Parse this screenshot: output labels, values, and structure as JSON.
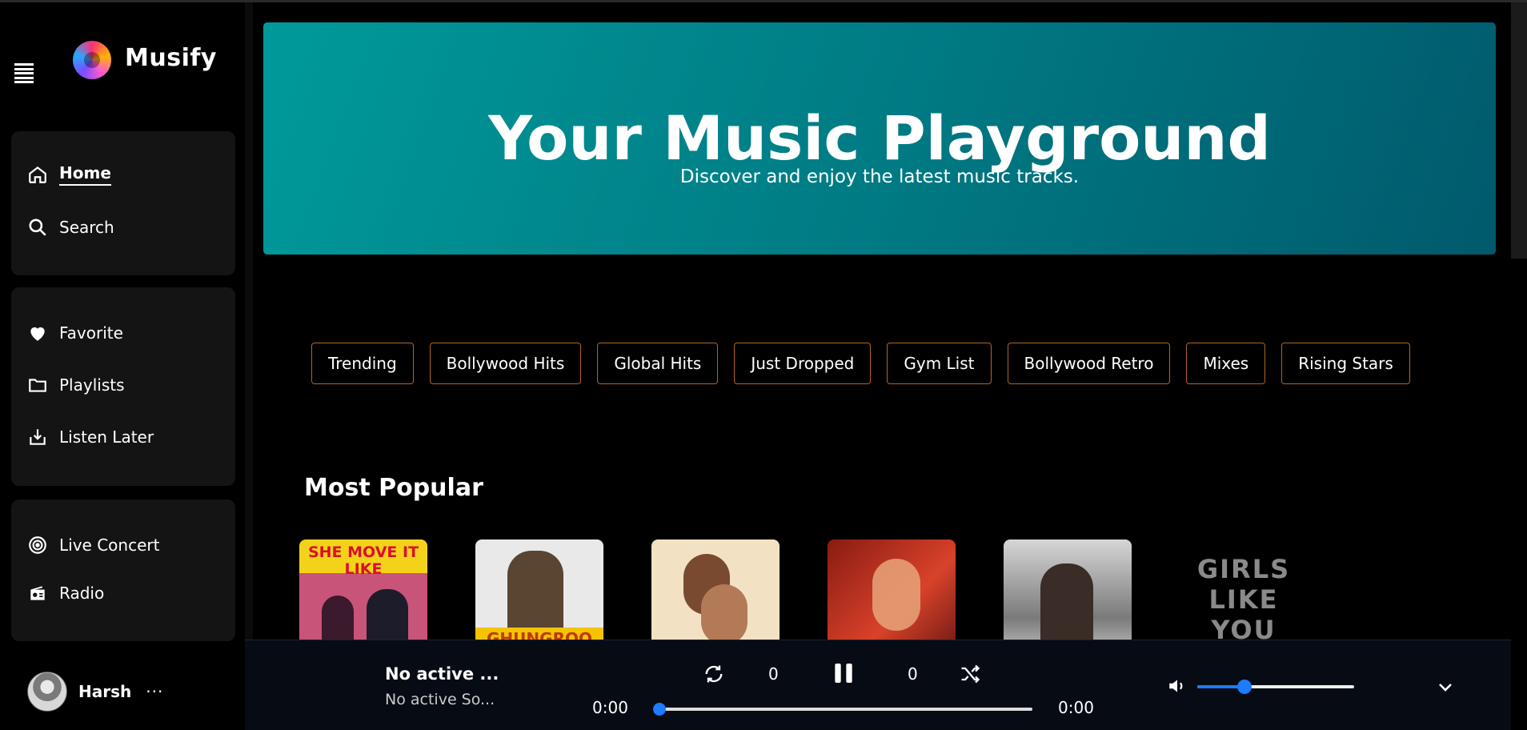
{
  "app": {
    "name": "Musify"
  },
  "sidebar": {
    "primary": [
      {
        "label": "Home",
        "icon": "home-icon",
        "active": true
      },
      {
        "label": "Search",
        "icon": "search-icon"
      }
    ],
    "library": [
      {
        "label": "Favorite",
        "icon": "heart-icon"
      },
      {
        "label": "Playlists",
        "icon": "folder-icon"
      },
      {
        "label": "Listen Later",
        "icon": "download-box-icon"
      }
    ],
    "live": [
      {
        "label": "Live Concert",
        "icon": "target-icon"
      },
      {
        "label": "Radio",
        "icon": "radio-icon"
      }
    ],
    "user": {
      "name": "Harsh",
      "more": "···"
    }
  },
  "hero": {
    "title": "Your Music Playground",
    "subtitle": "Discover and enjoy the latest music tracks."
  },
  "chips": [
    "Trending",
    "Bollywood Hits",
    "Global Hits",
    "Just Dropped",
    "Gym List",
    "Bollywood Retro",
    "Mixes",
    "Rising Stars"
  ],
  "sections": {
    "popular_title": "Most Popular"
  },
  "covers": [
    {
      "text": "SHE MOVE IT LIKE"
    },
    {
      "text": "GHUNGROO"
    },
    {
      "text": ""
    },
    {
      "text": ""
    },
    {
      "text": ""
    },
    {
      "text": "GIRLS LIKE YOU"
    }
  ],
  "player": {
    "title": "No active ...",
    "artist": "No active So...",
    "repeat_count": "0",
    "shuffle_count": "0",
    "current_time": "0:00",
    "duration": "0:00",
    "progress": 0,
    "volume": 0.3
  },
  "colors": {
    "accent": "#1e7bff",
    "chip_border": "#b5651d",
    "hero_start": "#009a9a",
    "hero_end": "#005a6c"
  }
}
